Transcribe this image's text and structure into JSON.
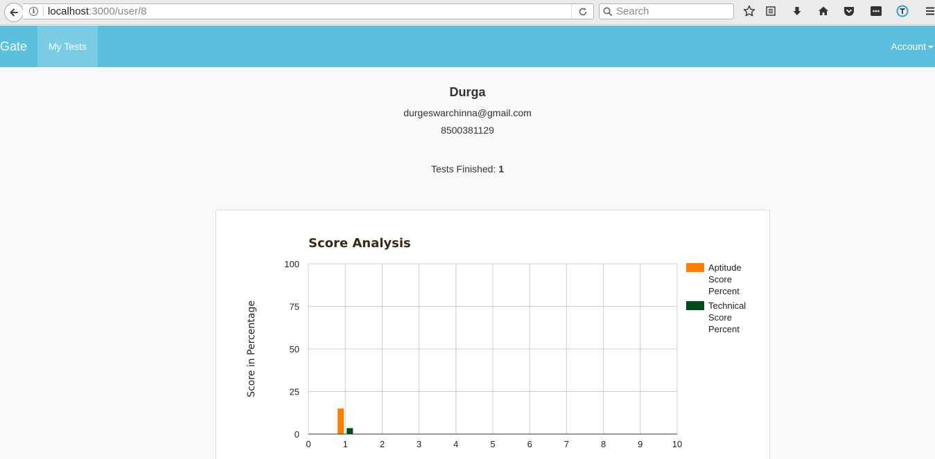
{
  "browser": {
    "url_host": "localhost",
    "url_path": ":3000/user/8",
    "search_placeholder": "Search"
  },
  "navbar": {
    "brand": "Gate",
    "my_tests": "My Tests",
    "account": "Account"
  },
  "profile": {
    "name": "Durga",
    "email": "durgeswarchinna@gmail.com",
    "phone": "8500381129",
    "tests_finished_label": "Tests Finished:",
    "tests_finished_count": "1"
  },
  "colors": {
    "navbar": "#5bc0de",
    "aptitude": "#ff7f00",
    "technical": "#004d1a"
  },
  "chart_data": {
    "type": "bar",
    "title": "Score Analysis",
    "ylabel": "Score in Percentage",
    "xlabel": "",
    "xlim": [
      0,
      10
    ],
    "ylim": [
      0,
      100
    ],
    "xticks": [
      "0",
      "1",
      "2",
      "3",
      "4",
      "5",
      "6",
      "7",
      "8",
      "9",
      "10"
    ],
    "yticks": [
      "0",
      "25",
      "50",
      "75",
      "100"
    ],
    "grid": true,
    "legend": "right",
    "series": [
      {
        "name": "Aptitude Score Percent",
        "color": "#ff7f00",
        "points": [
          {
            "x": 1,
            "y": 15
          }
        ]
      },
      {
        "name": "Technical Score Percent",
        "color": "#004d1a",
        "points": [
          {
            "x": 1,
            "y": 3.5
          }
        ]
      }
    ]
  }
}
